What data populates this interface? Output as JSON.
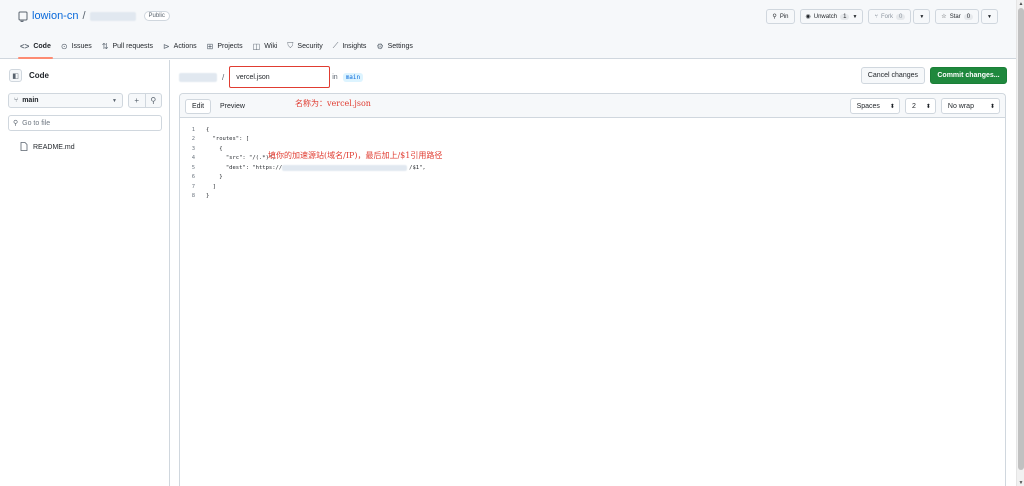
{
  "repo": {
    "owner": "lowion-cn",
    "separator": "/",
    "visibility": "Public"
  },
  "actions": {
    "pin": "Pin",
    "unwatch": "Unwatch",
    "watch_count": "1",
    "fork": "Fork",
    "fork_count": "0",
    "star": "Star",
    "star_count": "0"
  },
  "tabs": [
    {
      "label": "Code",
      "icon": "code-icon",
      "active": true
    },
    {
      "label": "Issues",
      "icon": "issue-icon"
    },
    {
      "label": "Pull requests",
      "icon": "pull-request-icon"
    },
    {
      "label": "Actions",
      "icon": "play-icon"
    },
    {
      "label": "Projects",
      "icon": "table-icon"
    },
    {
      "label": "Wiki",
      "icon": "book-icon"
    },
    {
      "label": "Security",
      "icon": "shield-icon"
    },
    {
      "label": "Insights",
      "icon": "graph-icon"
    },
    {
      "label": "Settings",
      "icon": "gear-icon"
    }
  ],
  "sidebar": {
    "title": "Code",
    "branch": "main",
    "search_placeholder": "Go to file",
    "files": [
      "README.md"
    ]
  },
  "editor": {
    "path_separator": "/",
    "filename": "vercel.json",
    "in_label": "in",
    "branch": "main",
    "cancel_label": "Cancel changes",
    "commit_label": "Commit changes...",
    "tab_edit": "Edit",
    "tab_preview": "Preview",
    "indent_mode": "Spaces",
    "indent_size": "2",
    "wrap_mode": "No wrap",
    "annotation_name": "名称为：vercel.json",
    "annotation_source": "填你的加速源站(域名/IP)，最后加上/$1引用路径",
    "lines": [
      {
        "n": "1",
        "text": "{"
      },
      {
        "n": "2",
        "text": "  \"routes\": ["
      },
      {
        "n": "3",
        "text": "    {"
      },
      {
        "n": "4",
        "text": "      \"src\": \"/(.*)\","
      },
      {
        "n": "5",
        "text": "      \"dest\": \"https://"
      },
      {
        "n": "6",
        "text": "    }"
      },
      {
        "n": "7",
        "text": "  ]"
      },
      {
        "n": "8",
        "text": "}"
      }
    ],
    "line5_suffix": "/$1\","
  },
  "colors": {
    "accent_green": "#1f883d",
    "annotation_red": "#e03c31",
    "link_blue": "#0969da"
  }
}
